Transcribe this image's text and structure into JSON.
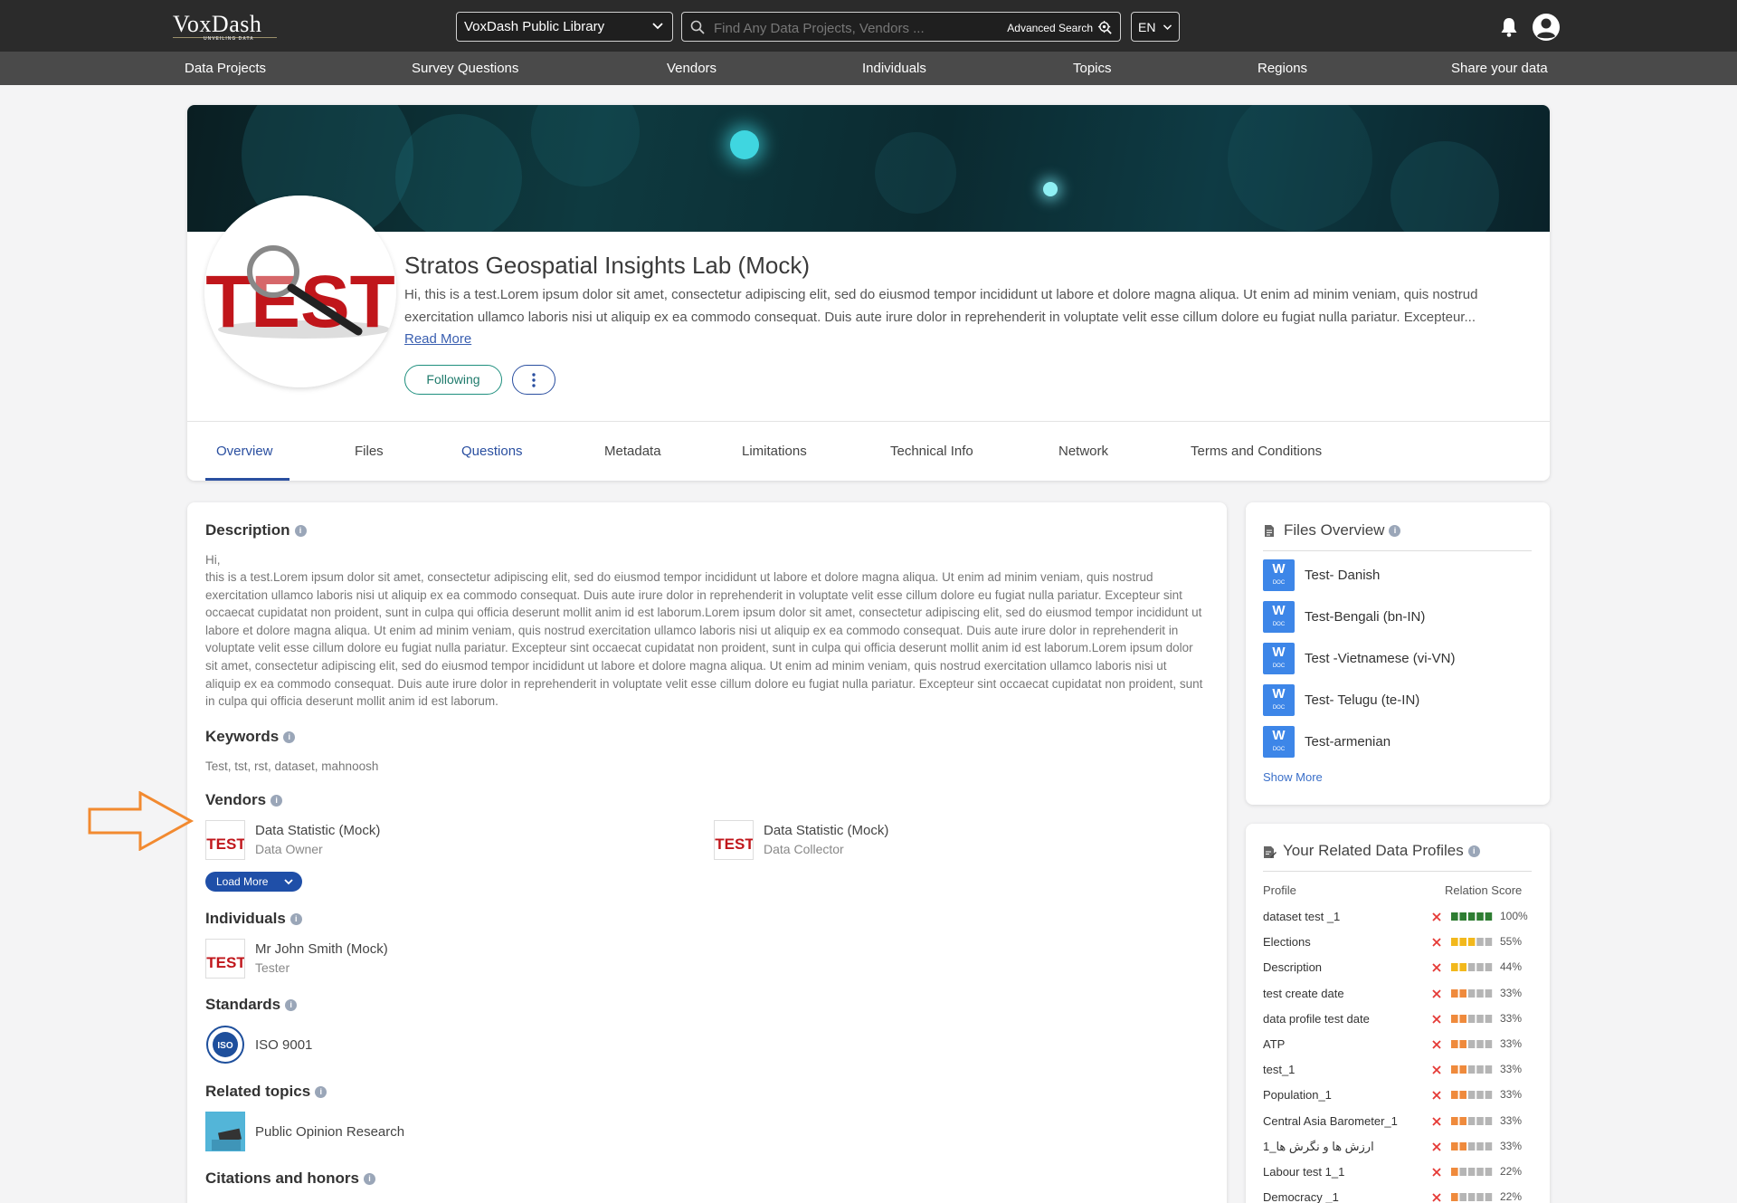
{
  "app": {
    "logo": "VoxDash",
    "logo_tagline": "UNVEILING DATA",
    "library_select": "VoxDash Public Library",
    "search_placeholder": "Find Any Data Projects, Vendors ...",
    "advanced_search": "Advanced Search",
    "language": "EN"
  },
  "nav": [
    "Data Projects",
    "Survey Questions",
    "Vendors",
    "Individuals",
    "Topics",
    "Regions",
    "Share your data"
  ],
  "profile": {
    "name": "Stratos Geospatial Insights Lab (Mock)",
    "summary": "Hi, this is a test.Lorem ipsum dolor sit amet, consectetur adipiscing elit, sed do eiusmod tempor incididunt ut labore et dolore magna aliqua. Ut enim ad minim veniam, quis nostrud exercitation ullamco laboris nisi ut aliquip ex ea commodo consequat. Duis aute irure dolor in reprehenderit in voluptate velit esse cillum dolore eu fugiat nulla pariatur. Excepteur...",
    "read_more": "Read More",
    "following_label": "Following",
    "avatar_text": "TEST"
  },
  "tabs": [
    "Overview",
    "Files",
    "Questions",
    "Metadata",
    "Limitations",
    "Technical Info",
    "Network",
    "Terms and Conditions"
  ],
  "description": {
    "title": "Description",
    "greeting": "Hi,",
    "text": "this is a test.Lorem ipsum dolor sit amet, consectetur adipiscing elit, sed do eiusmod tempor incididunt ut labore et dolore magna aliqua. Ut enim ad minim veniam, quis nostrud exercitation ullamco laboris nisi ut aliquip ex ea commodo consequat. Duis aute irure dolor in reprehenderit in voluptate velit esse cillum dolore eu fugiat nulla pariatur. Excepteur sint occaecat cupidatat non proident, sunt in culpa qui officia deserunt mollit anim id est laborum.Lorem ipsum dolor sit amet, consectetur adipiscing elit, sed do eiusmod tempor incididunt ut labore et dolore magna aliqua. Ut enim ad minim veniam, quis nostrud exercitation ullamco laboris nisi ut aliquip ex ea commodo consequat. Duis aute irure dolor in reprehenderit in voluptate velit esse cillum dolore eu fugiat nulla pariatur. Excepteur sint occaecat cupidatat non proident, sunt in culpa qui officia deserunt mollit anim id est laborum.Lorem ipsum dolor sit amet, consectetur adipiscing elit, sed do eiusmod tempor incididunt ut labore et dolore magna aliqua. Ut enim ad minim veniam, quis nostrud exercitation ullamco laboris nisi ut aliquip ex ea commodo consequat. Duis aute irure dolor in reprehenderit in voluptate velit esse cillum dolore eu fugiat nulla pariatur. Excepteur sint occaecat cupidatat non proident, sunt in culpa qui officia deserunt mollit anim id est laborum."
  },
  "keywords": {
    "title": "Keywords",
    "text": "Test, tst, rst, dataset, mahnoosh"
  },
  "vendors": {
    "title": "Vendors",
    "items": [
      {
        "name": "Data Statistic (Mock)",
        "role": "Data Owner"
      },
      {
        "name": "Data Statistic (Mock)",
        "role": "Data Collector"
      }
    ],
    "load_more": "Load More"
  },
  "individuals": {
    "title": "Individuals",
    "items": [
      {
        "name": "Mr John Smith (Mock)",
        "role": "Tester"
      }
    ]
  },
  "standards": {
    "title": "Standards",
    "items": [
      {
        "name": "ISO 9001",
        "badge": "ISO"
      }
    ]
  },
  "related_topics": {
    "title": "Related topics",
    "items": [
      {
        "name": "Public Opinion Research"
      }
    ]
  },
  "citations": {
    "title": "Citations and honors"
  },
  "files_overview": {
    "title": "Files Overview",
    "items": [
      "Test- Danish",
      "Test-Bengali (bn-IN)",
      "Test -Vietnamese (vi-VN)",
      "Test- Telugu (te-IN)",
      "Test-armenian"
    ],
    "icon_letter": "W",
    "icon_sub": "DOC",
    "show_more": "Show More"
  },
  "related_profiles": {
    "title": "Your Related Data Profiles",
    "col_profile": "Profile",
    "col_score": "Relation Score",
    "items": [
      {
        "name": "dataset test _1",
        "score": "100%",
        "filled": 5,
        "color": "#2e7d32"
      },
      {
        "name": "Elections",
        "score": "55%",
        "filled": 3,
        "color": "#f2b81c"
      },
      {
        "name": "Description",
        "score": "44%",
        "filled": 2,
        "color": "#f2b81c"
      },
      {
        "name": "test create date",
        "score": "33%",
        "filled": 2,
        "color": "#ef8a3c"
      },
      {
        "name": "data profile test date",
        "score": "33%",
        "filled": 2,
        "color": "#ef8a3c"
      },
      {
        "name": "ATP",
        "score": "33%",
        "filled": 2,
        "color": "#ef8a3c"
      },
      {
        "name": "test_1",
        "score": "33%",
        "filled": 2,
        "color": "#ef8a3c"
      },
      {
        "name": "Population_1",
        "score": "33%",
        "filled": 2,
        "color": "#ef8a3c"
      },
      {
        "name": "Central Asia Barometer_1",
        "score": "33%",
        "filled": 2,
        "color": "#ef8a3c"
      },
      {
        "name": "ارزش ها و نگرش ها_1",
        "score": "33%",
        "filled": 2,
        "color": "#ef8a3c"
      },
      {
        "name": "Labour test 1_1",
        "score": "22%",
        "filled": 1,
        "color": "#ef8a3c"
      },
      {
        "name": "Democracy _1",
        "score": "22%",
        "filled": 1,
        "color": "#ef8a3c"
      }
    ]
  },
  "colors": {
    "accent": "#2a4fa0",
    "follow": "#1e8f7e",
    "arrow": "#f28a30",
    "remove": "#e53935"
  }
}
